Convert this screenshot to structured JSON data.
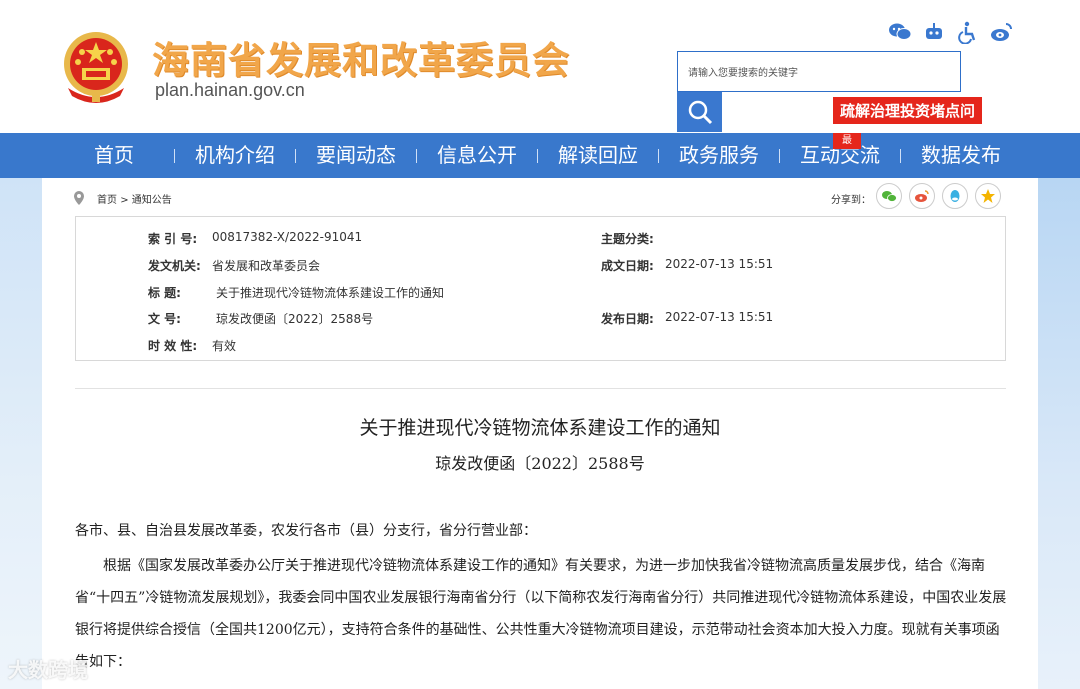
{
  "header": {
    "title": "海南省发展和改革委员会",
    "domain": "plan.hainan.gov.cn",
    "search_placeholder": "请输入您要搜索的关键字",
    "promo": "疏解治理投资堵点问"
  },
  "nav": {
    "items": [
      "首页",
      "机构介绍",
      "要闻动态",
      "信息公开",
      "解读回应",
      "政务服务",
      "互动交流",
      "数据发布"
    ],
    "hot_badge": "最"
  },
  "breadcrumb": {
    "home": "首页",
    "separator": ">",
    "current": "通知公告"
  },
  "share": {
    "label": "分享到："
  },
  "meta": {
    "index_label": "索  引  号:",
    "index_value": "00817382-X/2022-91041",
    "topic_label": "主题分类:",
    "topic_value": "",
    "issuer_label": "发文机关:",
    "issuer_value": "省发展和改革委员会",
    "date_written_label": "成文日期:",
    "date_written_value": "2022-07-13 15:51",
    "title_label": "标      题:",
    "title_value": "关于推进现代冷链物流体系建设工作的通知",
    "docno_label": "文      号:",
    "docno_value": "琼发改便函〔2022〕2588号",
    "pub_date_label": "发布日期:",
    "pub_date_value": "2022-07-13 15:51",
    "validity_label": "时  效  性:",
    "validity_value": "有效"
  },
  "article": {
    "title": "关于推进现代冷链物流体系建设工作的通知",
    "number": "琼发改便函〔2022〕2588号",
    "salutation": "各市、县、自治县发展改革委，农发行各市（县）分支行，省分行营业部：",
    "paragraph": "根据《国家发展改革委办公厅关于推进现代冷链物流体系建设工作的通知》有关要求，为进一步加快我省冷链物流高质量发展步伐，结合《海南省“十四五”冷链物流发展规划》，我委会同中国农业发展银行海南省分行（以下简称农发行海南省分行）共同推进现代冷链物流体系建设，中国农业发展银行将提供综合授信（全国共1200亿元），支持符合条件的基础性、公共性重大冷链物流项目建设，示范带动社会资本加大投入力度。现就有关事项函告如下："
  },
  "watermark": "大数跨境",
  "colors": {
    "nav_bg": "#3978cc",
    "title_orange": "#f1a64a",
    "promo_red": "#e5261b"
  }
}
